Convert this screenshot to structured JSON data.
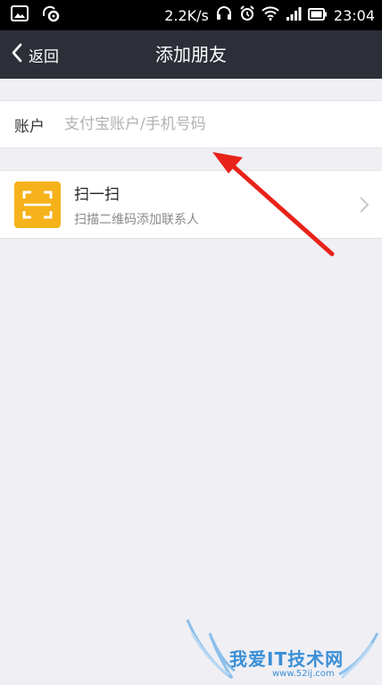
{
  "status_bar": {
    "network_speed": "2.2K/s",
    "time": "23:04",
    "icons": [
      "image-icon",
      "headset-notify-icon",
      "headphones-icon",
      "alarm-icon",
      "wifi-icon",
      "signal-icon",
      "battery-icon"
    ]
  },
  "nav": {
    "back_label": "返回",
    "title": "添加朋友",
    "background": "#2c2f38"
  },
  "account": {
    "label": "账户",
    "value": "",
    "placeholder": "支付宝账户/手机号码"
  },
  "scan": {
    "title": "扫一扫",
    "subtitle": "扫描二维码添加联系人",
    "icon_color": "#f6b21a"
  },
  "annotation": {
    "arrow_color": "#e8231a"
  },
  "watermark": {
    "text": "我爱IT技术网",
    "url": "www.52ij.com"
  }
}
